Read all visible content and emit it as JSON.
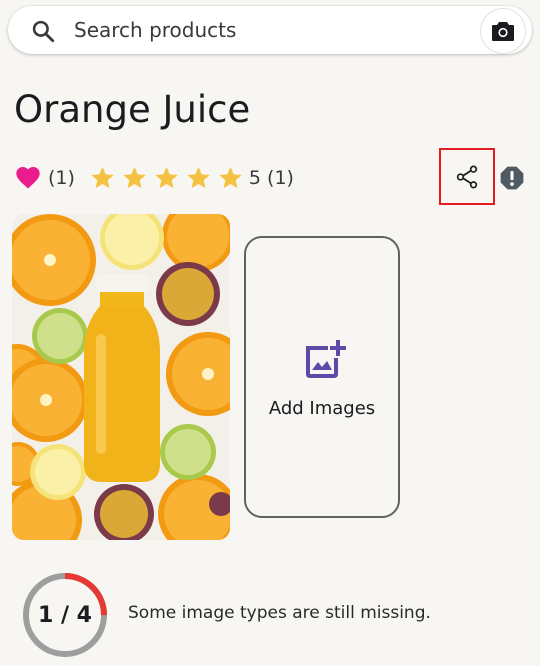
{
  "search": {
    "placeholder": "Search products",
    "icon": "search-icon",
    "camera_icon": "camera-icon"
  },
  "product": {
    "title": "Orange Juice",
    "favorites_count": "(1)",
    "rating_stars": 5,
    "rating_text": "5 (1)",
    "image_description": "orange-juice-bottle-photo"
  },
  "actions": {
    "share_icon": "share-icon",
    "report_icon": "report-icon"
  },
  "add_images": {
    "label": "Add Images",
    "icon": "add-photo-icon"
  },
  "progress": {
    "label": "1 / 4",
    "current": 1,
    "total": 4,
    "message": "Some image types are still missing."
  },
  "colors": {
    "accent_heart": "#e91e8c",
    "star": "#f5c242",
    "highlight_border": "#e11d21",
    "progress_filled": "#e53935",
    "progress_track": "#9e9e9e",
    "add_icon": "#5b4aa6"
  }
}
